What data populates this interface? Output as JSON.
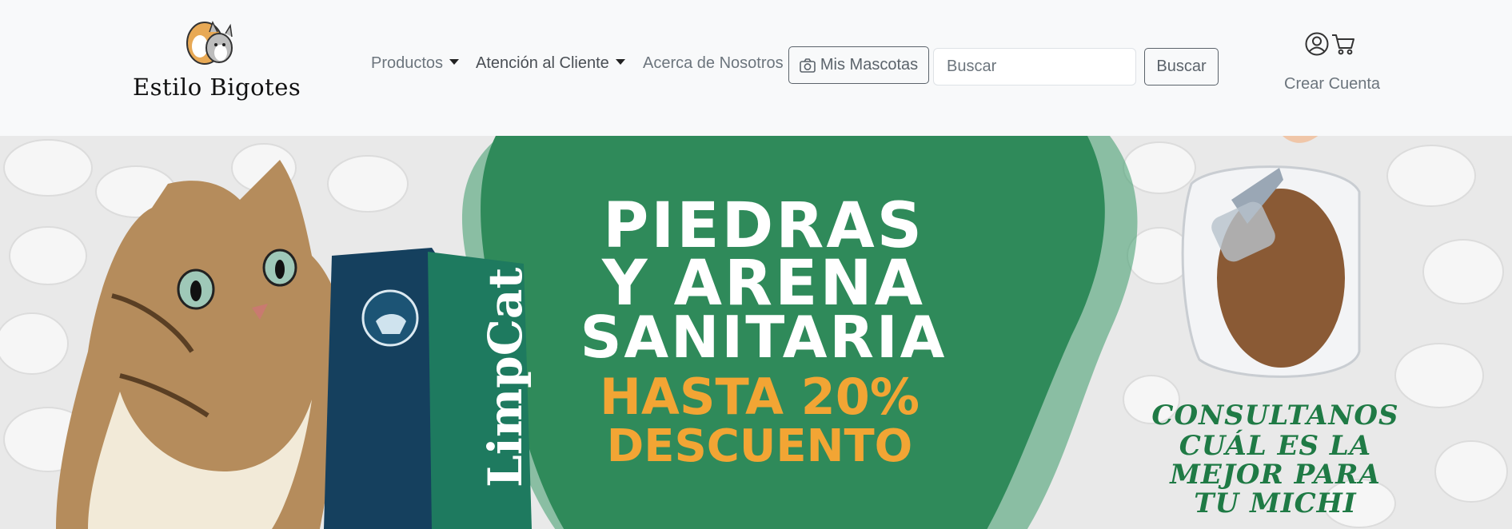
{
  "navbar": {
    "brand_name": "Estilo Bigotes",
    "links": {
      "productos": "Productos",
      "atencion": "Atención al Cliente",
      "acerca": "Acerca de Nosotros"
    },
    "mis_mascotas_label": "Mis Mascotas",
    "search": {
      "placeholder": "Buscar",
      "button_label": "Buscar"
    },
    "crear_cuenta": "Crear Cuenta"
  },
  "banner": {
    "headline_1": "PIEDRAS",
    "headline_2": "Y ARENA",
    "headline_3": "SANITARIA",
    "promo_1": "HASTA 20%",
    "promo_2": "DESCUENTO",
    "side_1": "CONSULTANOS",
    "side_2": "CUÁL ES LA",
    "side_3": "MEJOR PARA",
    "side_4": "TU MICHI",
    "product_brand": "LimpCat"
  },
  "colors": {
    "navbar_bg": "#f8f9fa",
    "muted_text": "#6c757d",
    "banner_green": "#2f8a5a",
    "promo_orange": "#f2a534",
    "side_green": "#1f7a45"
  }
}
